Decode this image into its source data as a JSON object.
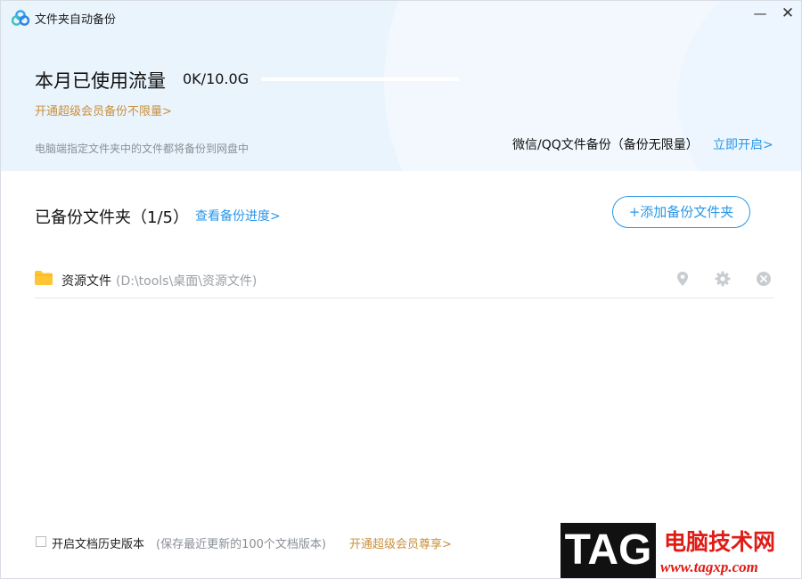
{
  "window": {
    "title": "文件夹自动备份",
    "minimize_label": "—",
    "close_label": "✕"
  },
  "quota": {
    "label": "本月已使用流量",
    "value": "0K/10.0G",
    "used_fraction": 0.0,
    "upgrade_link": "开通超级会员备份不限量>",
    "description": "电脑端指定文件夹中的文件都将备份到网盘中",
    "wechat_qq_text": "微信/QQ文件备份（备份无限量）",
    "wechat_qq_link": "立即开启>"
  },
  "backup": {
    "title": "已备份文件夹（1/5）",
    "progress_link": "查看备份进度>",
    "add_button": "+添加备份文件夹",
    "folders": [
      {
        "name": "资源文件",
        "path": "(D:\\tools\\桌面\\资源文件)"
      }
    ]
  },
  "footer": {
    "history_label": "开启文档历史版本",
    "history_checked": false,
    "history_note": "(保存最近更新的100个文档版本)",
    "vip_link": "开通超级会员尊享>"
  },
  "watermark": {
    "tag": "TAG",
    "site": "电脑技术网",
    "url": "www.tagxp.com"
  },
  "colors": {
    "accent": "#2a97e8",
    "gold": "#c9913d",
    "header_bg": "#e9f4fd",
    "folder": "#ffc533",
    "watermark_red": "#e01c17"
  },
  "icons": {
    "app": "cloud-logo-icon",
    "folder": "folder-icon",
    "locate": "location-pin-icon",
    "settings": "gear-icon",
    "remove": "close-circle-icon"
  }
}
